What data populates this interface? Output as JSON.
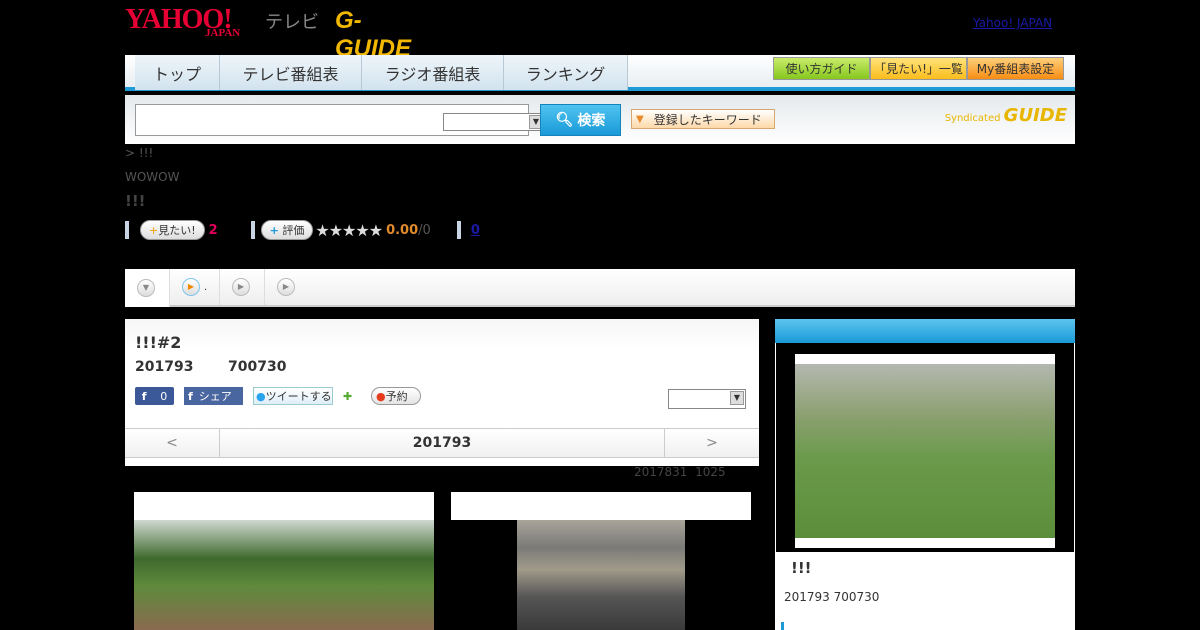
{
  "header": {
    "logo_yahoo": "YAHOO!",
    "logo_japan": "JAPAN",
    "logo_tv": "テレビ",
    "logo_gguide": "G-GUIDE",
    "yahoo_japan_link": "Yahoo! JAPAN"
  },
  "nav": {
    "tabs": [
      "トップ",
      "テレビ番組表",
      "ラジオ番組表",
      "ランキング"
    ],
    "tools": [
      "使い方ガイド",
      "「見たい!」一覧",
      "My番組表設定"
    ]
  },
  "search": {
    "input_value": "",
    "select_value": "",
    "button_label": "検索",
    "keyword_button": "登録したキーワード",
    "syndicated": "Syndicated",
    "syndicated_logo": "GUIDE"
  },
  "program": {
    "breadcrumb": "> !!!",
    "channel": "WOWOW",
    "title": "!!!",
    "want_label": "見たい!",
    "want_count": "2",
    "rate_label": "評価",
    "stars": 5,
    "star_rating": 0,
    "rating": "0.00",
    "rating_count": "/0",
    "review_count": "0"
  },
  "tabs": [
    {
      "icon": "down-circle-icon",
      "label": ""
    },
    {
      "icon": "play-orange-icon",
      "label": "."
    },
    {
      "icon": "play-icon",
      "label": ""
    },
    {
      "icon": "play-icon",
      "label": ""
    }
  ],
  "episode": {
    "title": "!!!#2",
    "date": "201793",
    "time": "700730",
    "fb_like_count": "0",
    "fb_share": "シェア",
    "tweet": "ツイートする",
    "reserve": "予約",
    "select_value": "",
    "prev": "<",
    "next": ">",
    "nav_date": "201793",
    "updated": "2017831  1025"
  },
  "sidebar": {
    "title": "!!!",
    "datetime": "201793  700730"
  },
  "colors": {
    "accent": "#1e9ad6",
    "want_count": "#e0005a",
    "rating": "#e08a2a"
  }
}
